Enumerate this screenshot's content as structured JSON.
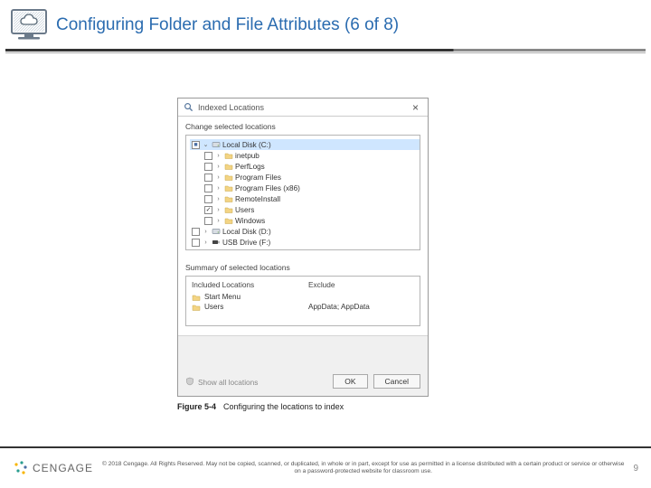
{
  "header": {
    "title": "Configuring Folder and File Attributes (6 of 8)"
  },
  "dialog": {
    "title": "Indexed Locations",
    "change_label": "Change selected locations",
    "tree": [
      {
        "indent": 0,
        "checked": "partial",
        "expand": "open",
        "icon": "disk",
        "label": "Local Disk (C:)",
        "selected": true
      },
      {
        "indent": 1,
        "checked": "no",
        "expand": "closed",
        "icon": "folder",
        "label": "inetpub"
      },
      {
        "indent": 1,
        "checked": "no",
        "expand": "closed",
        "icon": "folder",
        "label": "PerfLogs"
      },
      {
        "indent": 1,
        "checked": "no",
        "expand": "closed",
        "icon": "folder",
        "label": "Program Files"
      },
      {
        "indent": 1,
        "checked": "no",
        "expand": "closed",
        "icon": "folder",
        "label": "Program Files (x86)"
      },
      {
        "indent": 1,
        "checked": "no",
        "expand": "closed",
        "icon": "folder",
        "label": "RemoteInstall"
      },
      {
        "indent": 1,
        "checked": "yes",
        "expand": "closed",
        "icon": "folder",
        "label": "Users"
      },
      {
        "indent": 1,
        "checked": "no",
        "expand": "closed",
        "icon": "folder",
        "label": "Windows"
      },
      {
        "indent": 0,
        "checked": "no",
        "expand": "closed",
        "icon": "disk",
        "label": "Local Disk (D:)"
      },
      {
        "indent": 0,
        "checked": "no",
        "expand": "closed",
        "icon": "usb",
        "label": "USB Drive (F:)"
      }
    ],
    "summary_label": "Summary of selected locations",
    "included_hdr": "Included Locations",
    "exclude_hdr": "Exclude",
    "included": [
      {
        "icon": "folder",
        "label": "Start Menu"
      },
      {
        "icon": "folder",
        "label": "Users"
      }
    ],
    "exclude": [
      "",
      "AppData; AppData"
    ],
    "show_all": "Show all locations",
    "ok": "OK",
    "cancel": "Cancel"
  },
  "caption": {
    "fig": "Figure 5-4",
    "text": "Configuring the locations to index"
  },
  "footer": {
    "brand": "CENGAGE",
    "copyright": "© 2018 Cengage. All Rights Reserved. May not be copied, scanned, or duplicated, in whole or in part, except for use as permitted in a license distributed with a certain product or service or otherwise on a password-protected website for classroom use.",
    "page": "9"
  }
}
